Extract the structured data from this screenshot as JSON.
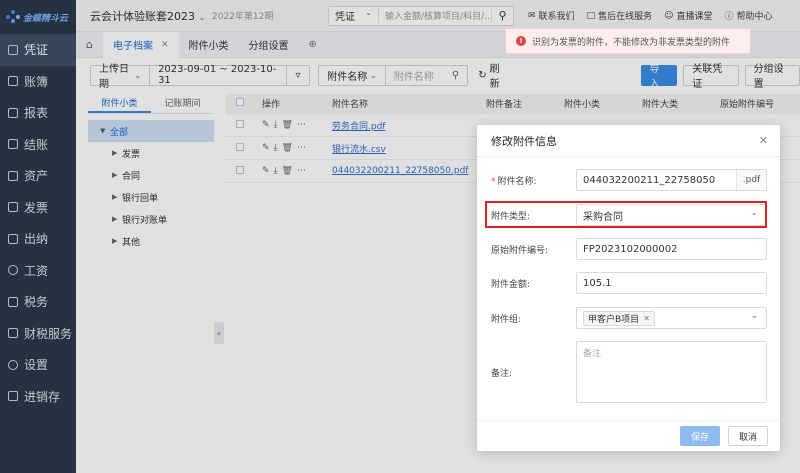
{
  "app": {
    "logo_text": "金蝶精斗云"
  },
  "sidebar": {
    "items": [
      {
        "label": "凭证",
        "icon": "voucher-icon"
      },
      {
        "label": "账簿",
        "icon": "ledger-icon"
      },
      {
        "label": "报表",
        "icon": "report-icon"
      },
      {
        "label": "结账",
        "icon": "closing-icon"
      },
      {
        "label": "资产",
        "icon": "asset-icon"
      },
      {
        "label": "发票",
        "icon": "invoice-icon"
      },
      {
        "label": "出纳",
        "icon": "cashier-icon"
      },
      {
        "label": "工资",
        "icon": "salary-icon"
      },
      {
        "label": "税务",
        "icon": "tax-icon"
      },
      {
        "label": "财税服务",
        "icon": "service-icon"
      },
      {
        "label": "设置",
        "icon": "settings-icon"
      },
      {
        "label": "进销存",
        "icon": "inventory-icon"
      }
    ],
    "active_index": 0
  },
  "topbar": {
    "account_name": "云会计体验账套2023",
    "period": "2022年第12期",
    "search_type": "凭证",
    "search_placeholder": "输入金额/核算项目/科目/...",
    "links": [
      "联系我们",
      "售后在线服务",
      "直播课堂",
      "帮助中心"
    ]
  },
  "tabs": [
    {
      "label": "电子档案",
      "active": true,
      "closable": true
    },
    {
      "label": "附件小类",
      "active": false
    },
    {
      "label": "分组设置",
      "active": false
    }
  ],
  "toolbar": {
    "date_type": "上传日期",
    "date_range": "2023-09-01 ~ 2023-10-31",
    "filter_field": "附件名称",
    "filter_placeholder": "附件名称",
    "refresh": "刷新",
    "import": "导入",
    "link_voucher": "关联凭证",
    "group_settings": "分组设置"
  },
  "left_panel": {
    "tabs": [
      "附件小类",
      "记账期间"
    ],
    "tree": [
      {
        "label": "全部",
        "level": 0,
        "selected": true
      },
      {
        "label": "发票",
        "level": 1
      },
      {
        "label": "合同",
        "level": 1
      },
      {
        "label": "银行回单",
        "level": 1
      },
      {
        "label": "银行对账单",
        "level": 1
      },
      {
        "label": "其他",
        "level": 1
      }
    ]
  },
  "table": {
    "columns": [
      "操作",
      "附件名称",
      "附件备注",
      "附件小类",
      "附件大类",
      "原始附件编号"
    ],
    "rows": [
      {
        "name": "劳务合同.pdf"
      },
      {
        "name": "银行流水.csv"
      },
      {
        "name": "044032200211_22758050.pdf"
      }
    ]
  },
  "toast": {
    "message": "识别为发票的附件，不能修改为非发票类型的附件"
  },
  "modal": {
    "title": "修改附件信息",
    "fields": {
      "name_label": "附件名称:",
      "name_value": "044032200211_22758050",
      "name_suffix": ".pdf",
      "type_label": "附件类型:",
      "type_value": "采购合同",
      "orig_no_label": "原始附件编号:",
      "orig_no_value": "FP2023102000002",
      "amount_label": "附件金额:",
      "amount_value": "105.1",
      "group_label": "附件组:",
      "group_tag": "甲客户B项目",
      "remark_label": "备注:",
      "remark_placeholder": "备注"
    },
    "save": "保存",
    "cancel": "取消"
  }
}
